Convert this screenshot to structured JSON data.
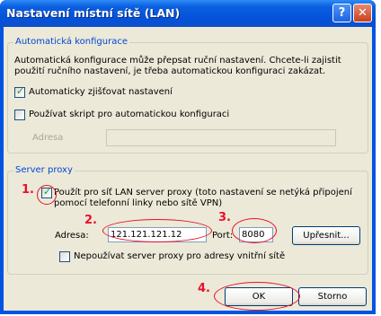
{
  "window": {
    "title": "Nastavení místní sítě (LAN)",
    "help_glyph": "?",
    "close_glyph": "✕"
  },
  "auto_config": {
    "legend": "Automatická konfigurace",
    "description_line1": "Automatická konfigurace může přepsat ruční nastavení. Chcete-li zajistit",
    "description_line2": "použití ručního nastavení, je třeba automatickou konfiguraci zakázat.",
    "auto_detect": {
      "label": "Automaticky zjišťovat nastavení",
      "checked": true
    },
    "use_script": {
      "label": "Používat skript pro automatickou konfiguraci",
      "checked": false
    },
    "address_label": "Adresa",
    "address_value": ""
  },
  "proxy": {
    "legend": "Server proxy",
    "use_proxy_line1": "Použít pro síť LAN server proxy (toto nastavení se netýká připojení",
    "use_proxy_line2": "pomocí telefonní linky nebo sítě VPN)",
    "use_proxy_checked": true,
    "address_label": "Adresa:",
    "address_value": "121.121.121.12",
    "port_label": "Port:",
    "port_value": "8080",
    "advanced_button": "Upřesnit...",
    "bypass_local": {
      "label": "Nepoužívat server proxy pro adresy vnitřní sítě",
      "checked": false
    }
  },
  "buttons": {
    "ok": "OK",
    "cancel": "Storno"
  },
  "annotations": {
    "step1": "1.",
    "step2": "2.",
    "step3": "3.",
    "step4": "4.",
    "color": "#e8102b"
  },
  "colors": {
    "titlebar": "#0054e3",
    "dialog_bg": "#ece9d8",
    "legend_text": "#0046d5"
  }
}
